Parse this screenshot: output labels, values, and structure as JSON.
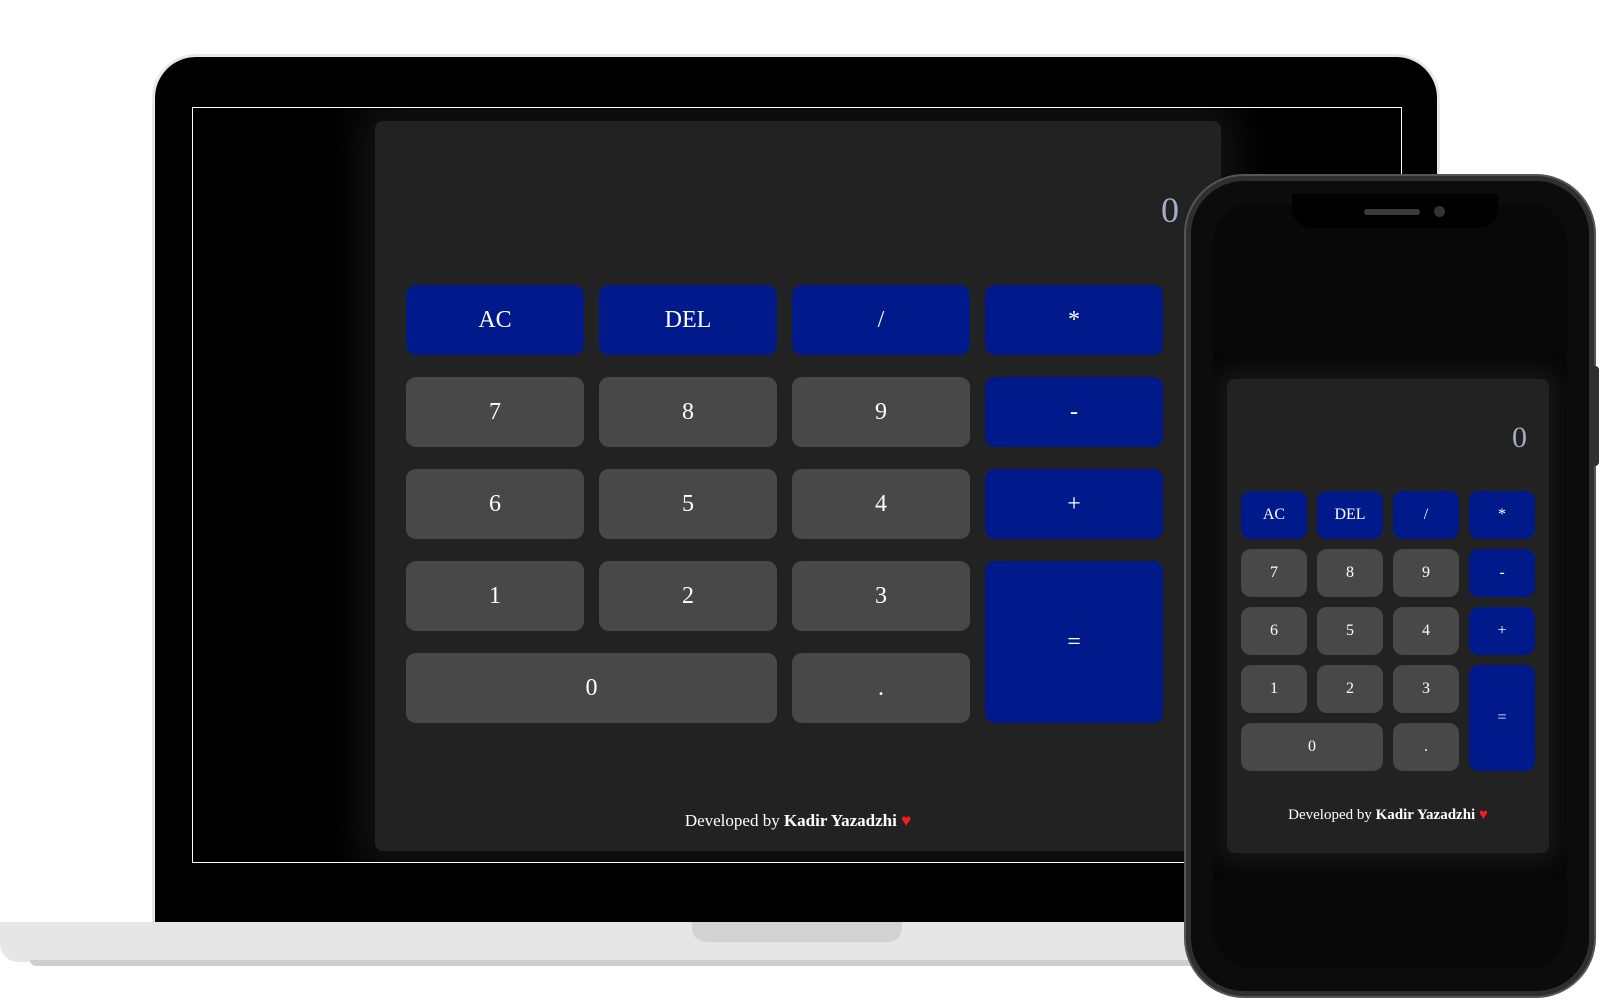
{
  "calculator": {
    "display": "0",
    "keys": {
      "ac": "AC",
      "del": "DEL",
      "divide": "/",
      "multiply": "*",
      "subtract": "-",
      "add": "+",
      "equals": "=",
      "seven": "7",
      "eight": "8",
      "nine": "9",
      "six": "6",
      "five": "5",
      "four": "4",
      "one": "1",
      "two": "2",
      "three": "3",
      "zero": "0",
      "decimal": "."
    },
    "footer": {
      "prefix": "Developed by",
      "author": "Kadir Yazadzhi",
      "heart": "♥"
    }
  },
  "colors": {
    "operator_key": "#001a8c",
    "number_key": "#484848",
    "calculator_bg": "#222222",
    "display_text": "#a9a9c8",
    "heart": "#ff1a1a"
  }
}
